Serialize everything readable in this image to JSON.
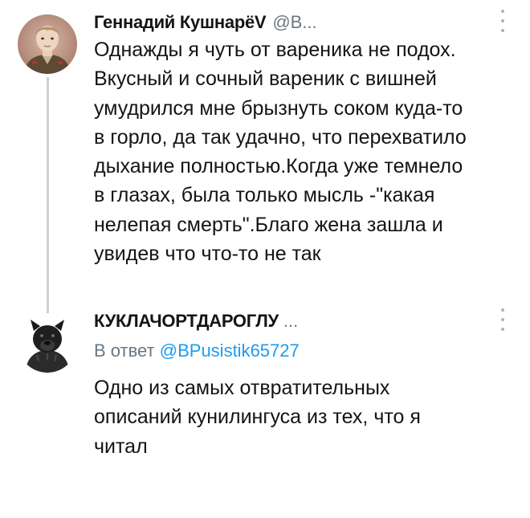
{
  "tweets": [
    {
      "name": "Геннадий КушнарёV",
      "handle": "@В...",
      "lines": [
        "Однажды я чуть от вареника не подох.",
        "Вкусный и сочный вареник с вишней",
        "умудрился мне брызнуть соком куда-то",
        "в горло, да так удачно, что перехватило",
        "дыхание полностью.Когда уже темнело",
        "в глазах, была только мысль -\"какая",
        "нелепая смерть\".Благо жена зашла и",
        "увидев что что-то не так"
      ],
      "avatar_icon": "child-soldier-portrait-avatar",
      "menu_icon": "more-vertical-icon"
    },
    {
      "name": "КУКЛАЧОРТДАРОГЛУ",
      "name_overflow": "...",
      "reply_prefix": "В ответ",
      "reply_handle": "@BPusistik65727",
      "lines": [
        "Одно из самых отвратительных",
        "описаний кунилингуса из тех, что я",
        "читал"
      ],
      "avatar_icon": "black-dog-avatar",
      "menu_icon": "more-vertical-icon"
    }
  ],
  "colors": {
    "text": "#141414",
    "secondary": "#6b7782",
    "link": "#1d9bf0",
    "thread_line": "#c9d1d8"
  }
}
